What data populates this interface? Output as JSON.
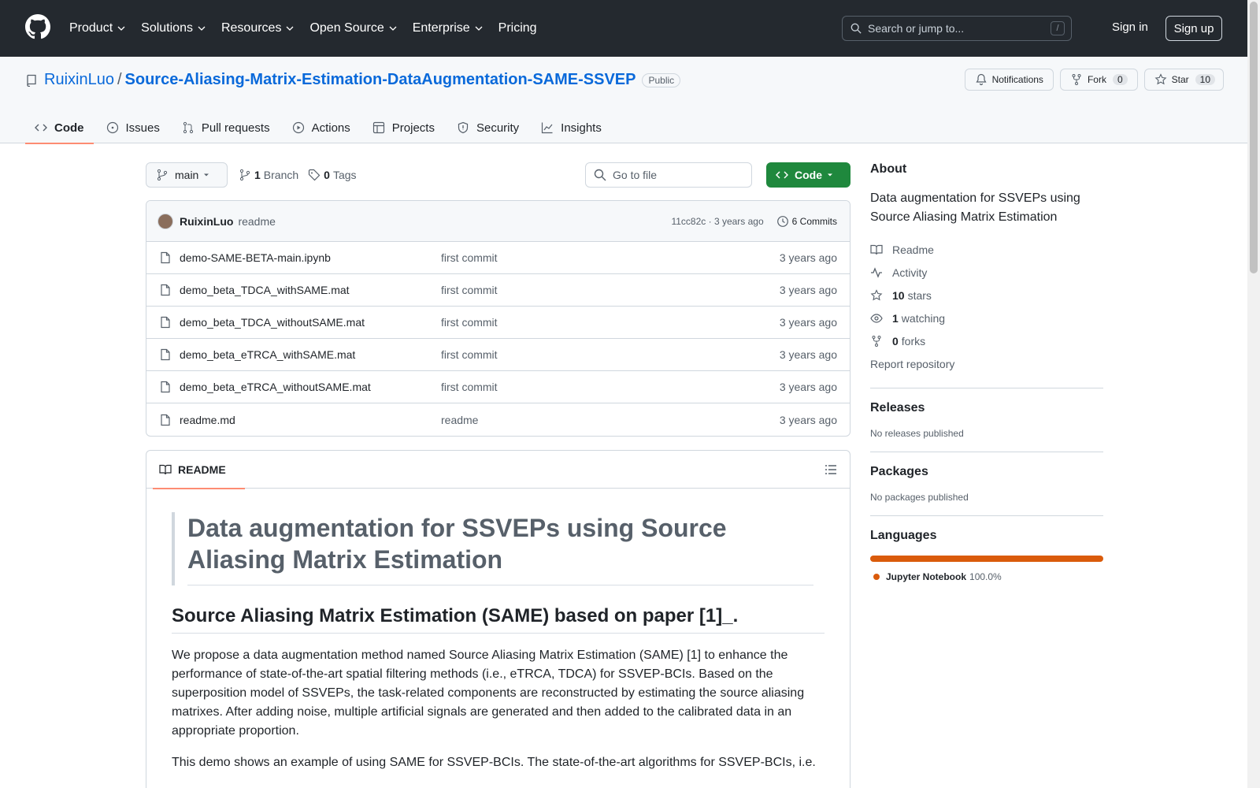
{
  "header": {
    "nav": [
      {
        "label": "Product",
        "dropdown": true
      },
      {
        "label": "Solutions",
        "dropdown": true
      },
      {
        "label": "Resources",
        "dropdown": true
      },
      {
        "label": "Open Source",
        "dropdown": true
      },
      {
        "label": "Enterprise",
        "dropdown": true
      },
      {
        "label": "Pricing",
        "dropdown": false
      }
    ],
    "search_placeholder": "Search or jump to...",
    "search_shortcut": "/",
    "signin": "Sign in",
    "signup": "Sign up"
  },
  "repo": {
    "owner": "RuixinLuo",
    "separator": "/",
    "name": "Source-Aliasing-Matrix-Estimation-DataAugmentation-SAME-SSVEP",
    "visibility": "Public",
    "notifications": "Notifications",
    "fork_label": "Fork",
    "fork_count": "0",
    "star_label": "Star",
    "star_count": "10"
  },
  "tabs": [
    {
      "label": "Code",
      "icon": "code-icon",
      "active": true
    },
    {
      "label": "Issues",
      "icon": "issue-icon",
      "active": false
    },
    {
      "label": "Pull requests",
      "icon": "pull-request-icon",
      "active": false
    },
    {
      "label": "Actions",
      "icon": "play-icon",
      "active": false
    },
    {
      "label": "Projects",
      "icon": "table-icon",
      "active": false
    },
    {
      "label": "Security",
      "icon": "shield-icon",
      "active": false
    },
    {
      "label": "Insights",
      "icon": "graph-icon",
      "active": false
    }
  ],
  "toolbar": {
    "branch": "main",
    "branch_count": "1",
    "branch_label": "Branch",
    "tag_count": "0",
    "tag_label": "Tags",
    "goto_placeholder": "Go to file",
    "code_button": "Code"
  },
  "latest_commit": {
    "author": "RuixinLuo",
    "message": "readme",
    "sha_time": "11cc82c · 3 years ago",
    "commits": "6 Commits"
  },
  "files": [
    {
      "name": "demo-SAME-BETA-main.ipynb",
      "commit": "first commit",
      "date": "3 years ago"
    },
    {
      "name": "demo_beta_TDCA_withSAME.mat",
      "commit": "first commit",
      "date": "3 years ago"
    },
    {
      "name": "demo_beta_TDCA_withoutSAME.mat",
      "commit": "first commit",
      "date": "3 years ago"
    },
    {
      "name": "demo_beta_eTRCA_withSAME.mat",
      "commit": "first commit",
      "date": "3 years ago"
    },
    {
      "name": "demo_beta_eTRCA_withoutSAME.mat",
      "commit": "first commit",
      "date": "3 years ago"
    },
    {
      "name": "readme.md",
      "commit": "readme",
      "date": "3 years ago"
    }
  ],
  "readme": {
    "tab": "README",
    "h1": "Data augmentation for SSVEPs using Source Aliasing Matrix Estimation",
    "h2": "Source Aliasing Matrix Estimation (SAME) based on paper [1]_.",
    "p1": "We propose a data augmentation method named Source Aliasing Matrix Estimation (SAME) [1] to enhance the performance of state-of-the-art spatial filtering methods (i.e., eTRCA, TDCA) for SSVEP-BCIs. Based on the superposition model of SSVEPs, the task-related components are reconstructed by estimating the source aliasing matrixes. After adding noise, multiple artificial signals are generated and then added to the calibrated data in an appropriate proportion.",
    "p2": "This demo shows an example of using SAME for SSVEP-BCIs. The state-of-the-art algorithms for SSVEP-BCIs, i.e."
  },
  "about": {
    "title": "About",
    "description": "Data augmentation for SSVEPs using Source Aliasing Matrix Estimation",
    "links": [
      {
        "icon": "book-icon",
        "bold": "",
        "text": "Readme"
      },
      {
        "icon": "pulse-icon",
        "bold": "",
        "text": "Activity"
      },
      {
        "icon": "star-icon",
        "bold": "10",
        "text": "stars"
      },
      {
        "icon": "eye-icon",
        "bold": "1",
        "text": "watching"
      },
      {
        "icon": "fork-icon",
        "bold": "0",
        "text": "forks"
      }
    ],
    "report": "Report repository"
  },
  "releases": {
    "title": "Releases",
    "text": "No releases published"
  },
  "packages": {
    "title": "Packages",
    "text": "No packages published"
  },
  "languages": {
    "title": "Languages",
    "items": [
      {
        "name": "Jupyter Notebook",
        "percent": "100.0%",
        "color": "#da5b0b",
        "share": 1.0
      }
    ]
  }
}
